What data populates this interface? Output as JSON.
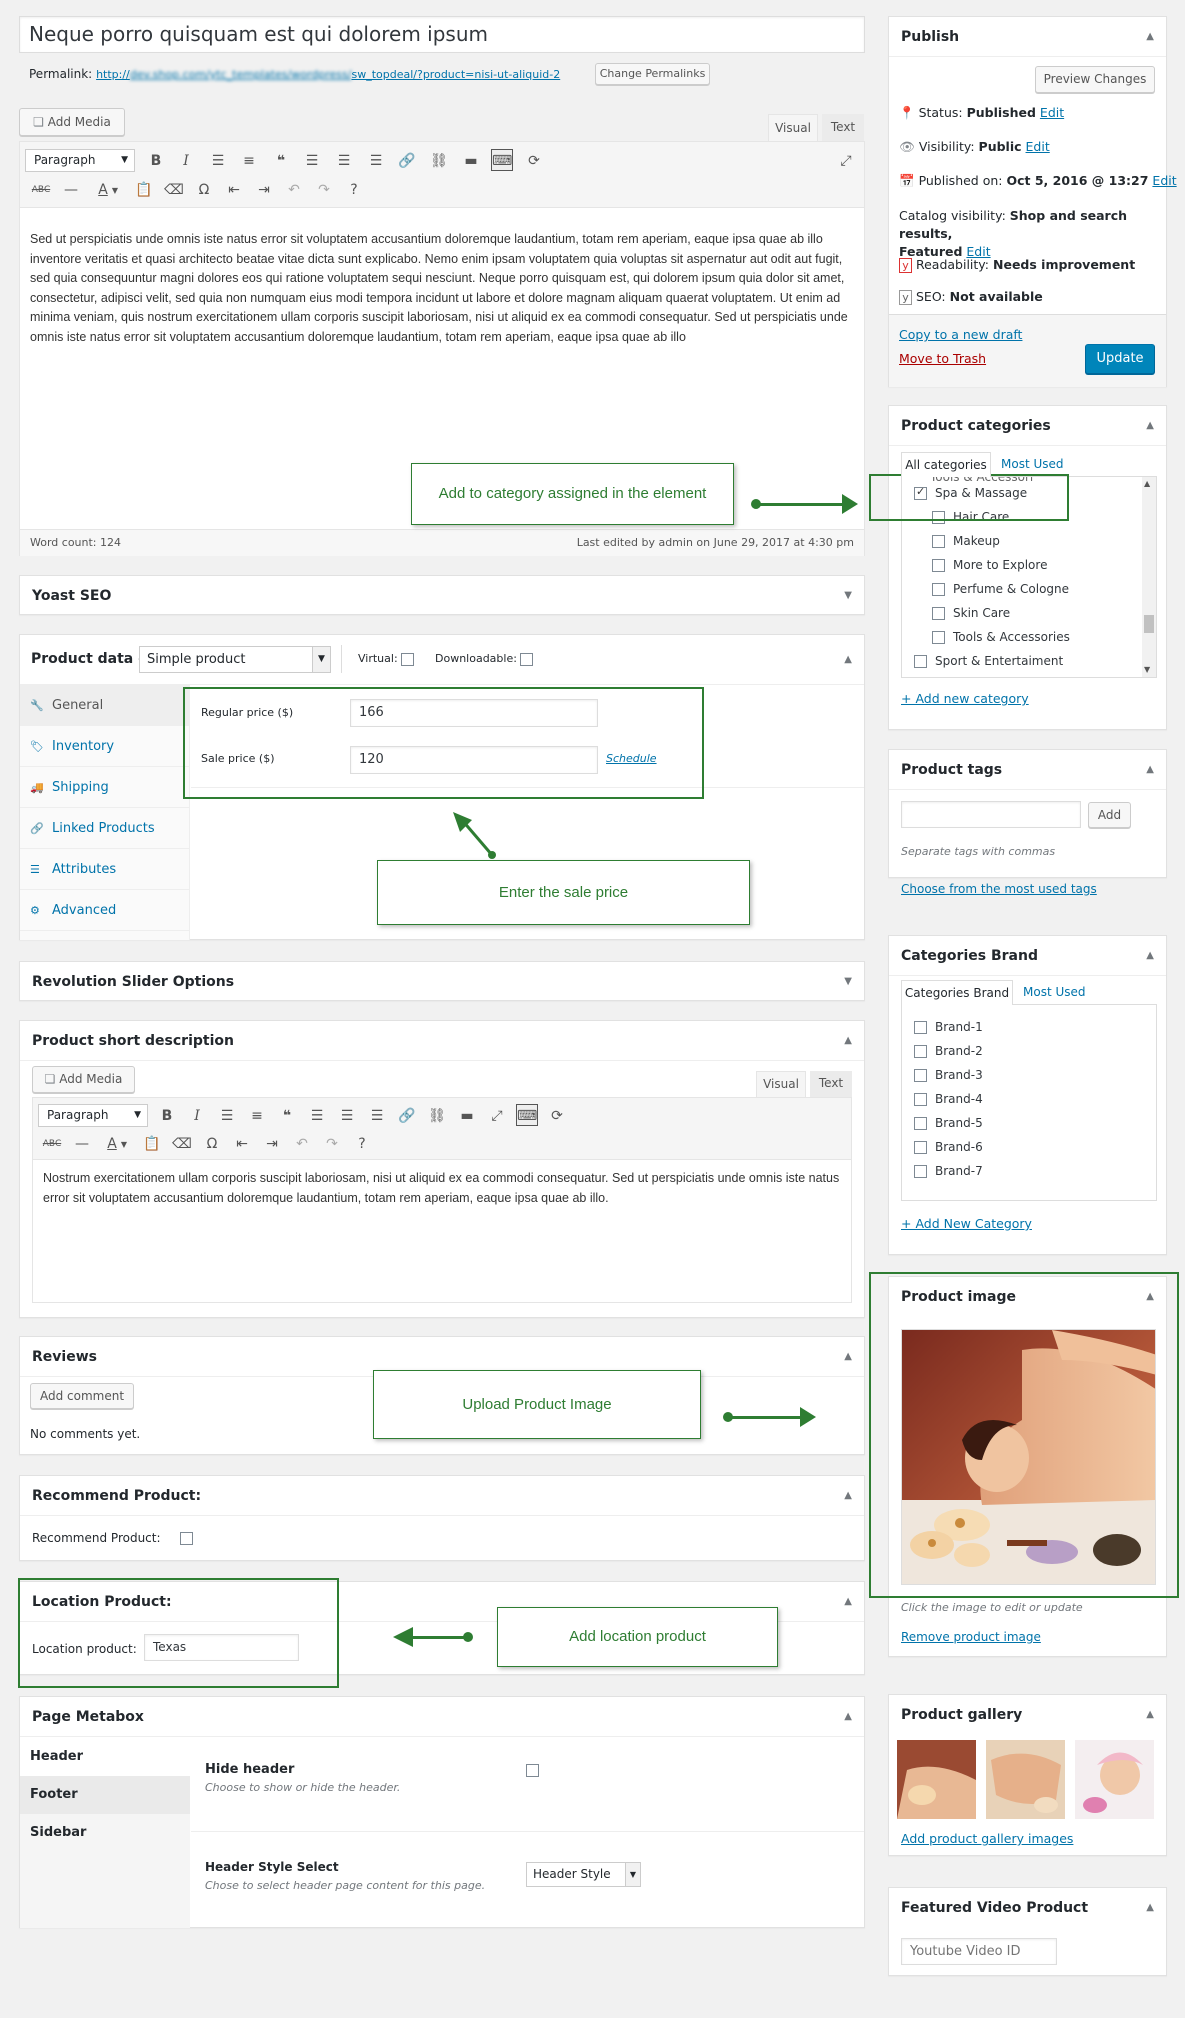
{
  "editor": {
    "title": "Neque porro quisquam est qui dolorem ipsum",
    "permalink_label": "Permalink:",
    "permalink_url": "http://dev.shop.com/ytc_templates/wordpress/sw_topdeal/?product=nisi-ut-aliquid-2",
    "change_permalinks": "Change Permalinks",
    "add_media": "Add Media",
    "tab_visual": "Visual",
    "tab_text": "Text",
    "format_select": "Paragraph",
    "content": "Sed ut perspiciatis unde omnis iste natus error sit voluptatem accusantium doloremque laudantium, totam rem aperiam, eaque ipsa quae ab illo inventore veritatis et quasi architecto beatae vitae dicta sunt explicabo. Nemo enim ipsam voluptatem quia voluptas sit aspernatur aut odit aut fugit, sed quia consequuntur magni dolores eos qui ratione voluptatem sequi nesciunt. Neque porro quisquam est, qui dolorem ipsum quia dolor sit amet, consectetur, adipisci velit, sed quia non numquam eius modi tempora incidunt ut labore et dolore magnam aliquam quaerat voluptatem. Ut enim ad minima veniam, quis nostrum exercitationem ullam corporis suscipit laboriosam, nisi ut aliquid ex ea commodi consequatur. Sed ut perspiciatis unde omnis iste natus error sit voluptatem accusantium doloremque laudantium, totam rem aperiam, eaque ipsa quae ab illo",
    "word_count": "Word count: 124",
    "last_edited": "Last edited by admin on June 29, 2017 at 4:30 pm"
  },
  "yoast": {
    "title": "Yoast SEO"
  },
  "product_data": {
    "title": "Product data —",
    "type_select": "Simple product",
    "virtual_label": "Virtual:",
    "downloadable_label": "Downloadable:",
    "tabs": [
      "General",
      "Inventory",
      "Shipping",
      "Linked Products",
      "Attributes",
      "Advanced"
    ],
    "tab_icons": [
      "wrench-icon",
      "tag-icon",
      "truck-icon",
      "link-icon",
      "list-icon",
      "gear-icon"
    ],
    "regular_price_label": "Regular price ($)",
    "regular_price_value": "166",
    "sale_price_label": "Sale price ($)",
    "sale_price_value": "120",
    "schedule_link": "Schedule"
  },
  "revslider": {
    "title": "Revolution Slider Options"
  },
  "short_desc": {
    "title": "Product short description",
    "add_media": "Add Media",
    "tab_visual": "Visual",
    "tab_text": "Text",
    "format_select": "Paragraph",
    "content": "Nostrum exercitationem ullam corporis suscipit laboriosam, nisi ut aliquid ex ea commodi consequatur. Sed ut perspiciatis unde omnis iste natus error sit voluptatem accusantium doloremque laudantium, totam rem aperiam, eaque ipsa quae ab illo."
  },
  "reviews": {
    "title": "Reviews",
    "add_comment": "Add comment",
    "empty": "No comments yet."
  },
  "recommend": {
    "title": "Recommend Product:",
    "label": "Recommend Product:"
  },
  "location": {
    "title": "Location Product:",
    "label": "Location product:",
    "value": "Texas"
  },
  "page_metabox": {
    "title": "Page Metabox",
    "tabs": [
      "Header",
      "Footer",
      "Sidebar"
    ],
    "hide_header_label": "Hide header",
    "hide_header_desc": "Choose to show or hide the header.",
    "header_style_label": "Header Style Select",
    "header_style_desc": "Chose to select header page content for this page.",
    "header_style_value": "Header Style"
  },
  "publish": {
    "title": "Publish",
    "preview": "Preview Changes",
    "status_label": "Status:",
    "status_value": "Published",
    "visibility_label": "Visibility:",
    "visibility_value": "Public",
    "published_label": "Published on:",
    "published_value": "Oct 5, 2016 @ 13:27",
    "catalog_label": "Catalog visibility:",
    "catalog_value": "Shop and search results,",
    "catalog_value2": "Featured",
    "edit": "Edit",
    "readability_label": "Readability:",
    "readability_value": "Needs improvement",
    "seo_label": "SEO:",
    "seo_value": "Not available",
    "copy_draft": "Copy to a new draft",
    "trash": "Move to Trash",
    "update": "Update"
  },
  "categories": {
    "title": "Product categories",
    "tab_all": "All categories",
    "tab_most": "Most Used",
    "items_cut": "Tools & Accessori",
    "items": [
      {
        "label": "Spa & Massage",
        "checked": true,
        "indent": 0
      },
      {
        "label": "Hair Care",
        "checked": false,
        "indent": 1
      },
      {
        "label": "Makeup",
        "checked": false,
        "indent": 1
      },
      {
        "label": "More to Explore",
        "checked": false,
        "indent": 1
      },
      {
        "label": "Perfume & Cologne",
        "checked": false,
        "indent": 1
      },
      {
        "label": "Skin Care",
        "checked": false,
        "indent": 1
      },
      {
        "label": "Tools & Accessories",
        "checked": false,
        "indent": 1
      },
      {
        "label": "Sport & Entertaiment",
        "checked": false,
        "indent": 0
      }
    ],
    "add_new": "+ Add new category"
  },
  "tags": {
    "title": "Product tags",
    "add": "Add",
    "hint": "Separate tags with commas",
    "choose": "Choose from the most used tags"
  },
  "brands": {
    "title": "Categories Brand",
    "tab_all": "Categories Brand",
    "tab_most": "Most Used",
    "items": [
      "Brand-1",
      "Brand-2",
      "Brand-3",
      "Brand-4",
      "Brand-5",
      "Brand-6",
      "Brand-7"
    ],
    "add_new": "+ Add New Category"
  },
  "product_image": {
    "title": "Product image",
    "hint": "Click the image to edit or update",
    "remove": "Remove product image"
  },
  "gallery": {
    "title": "Product gallery",
    "add": "Add product gallery images"
  },
  "video": {
    "title": "Featured Video Product",
    "placeholder": "Youtube Video ID"
  },
  "annotations": {
    "category": "Add to category assigned in the element",
    "sale": "Enter the sale price",
    "image": "Upload Product Image",
    "location": "Add location product"
  },
  "colors": {
    "accent": "#0073aa",
    "annotation": "#2e7d32",
    "primary_btn": "#0085ba",
    "trash": "#a00"
  }
}
